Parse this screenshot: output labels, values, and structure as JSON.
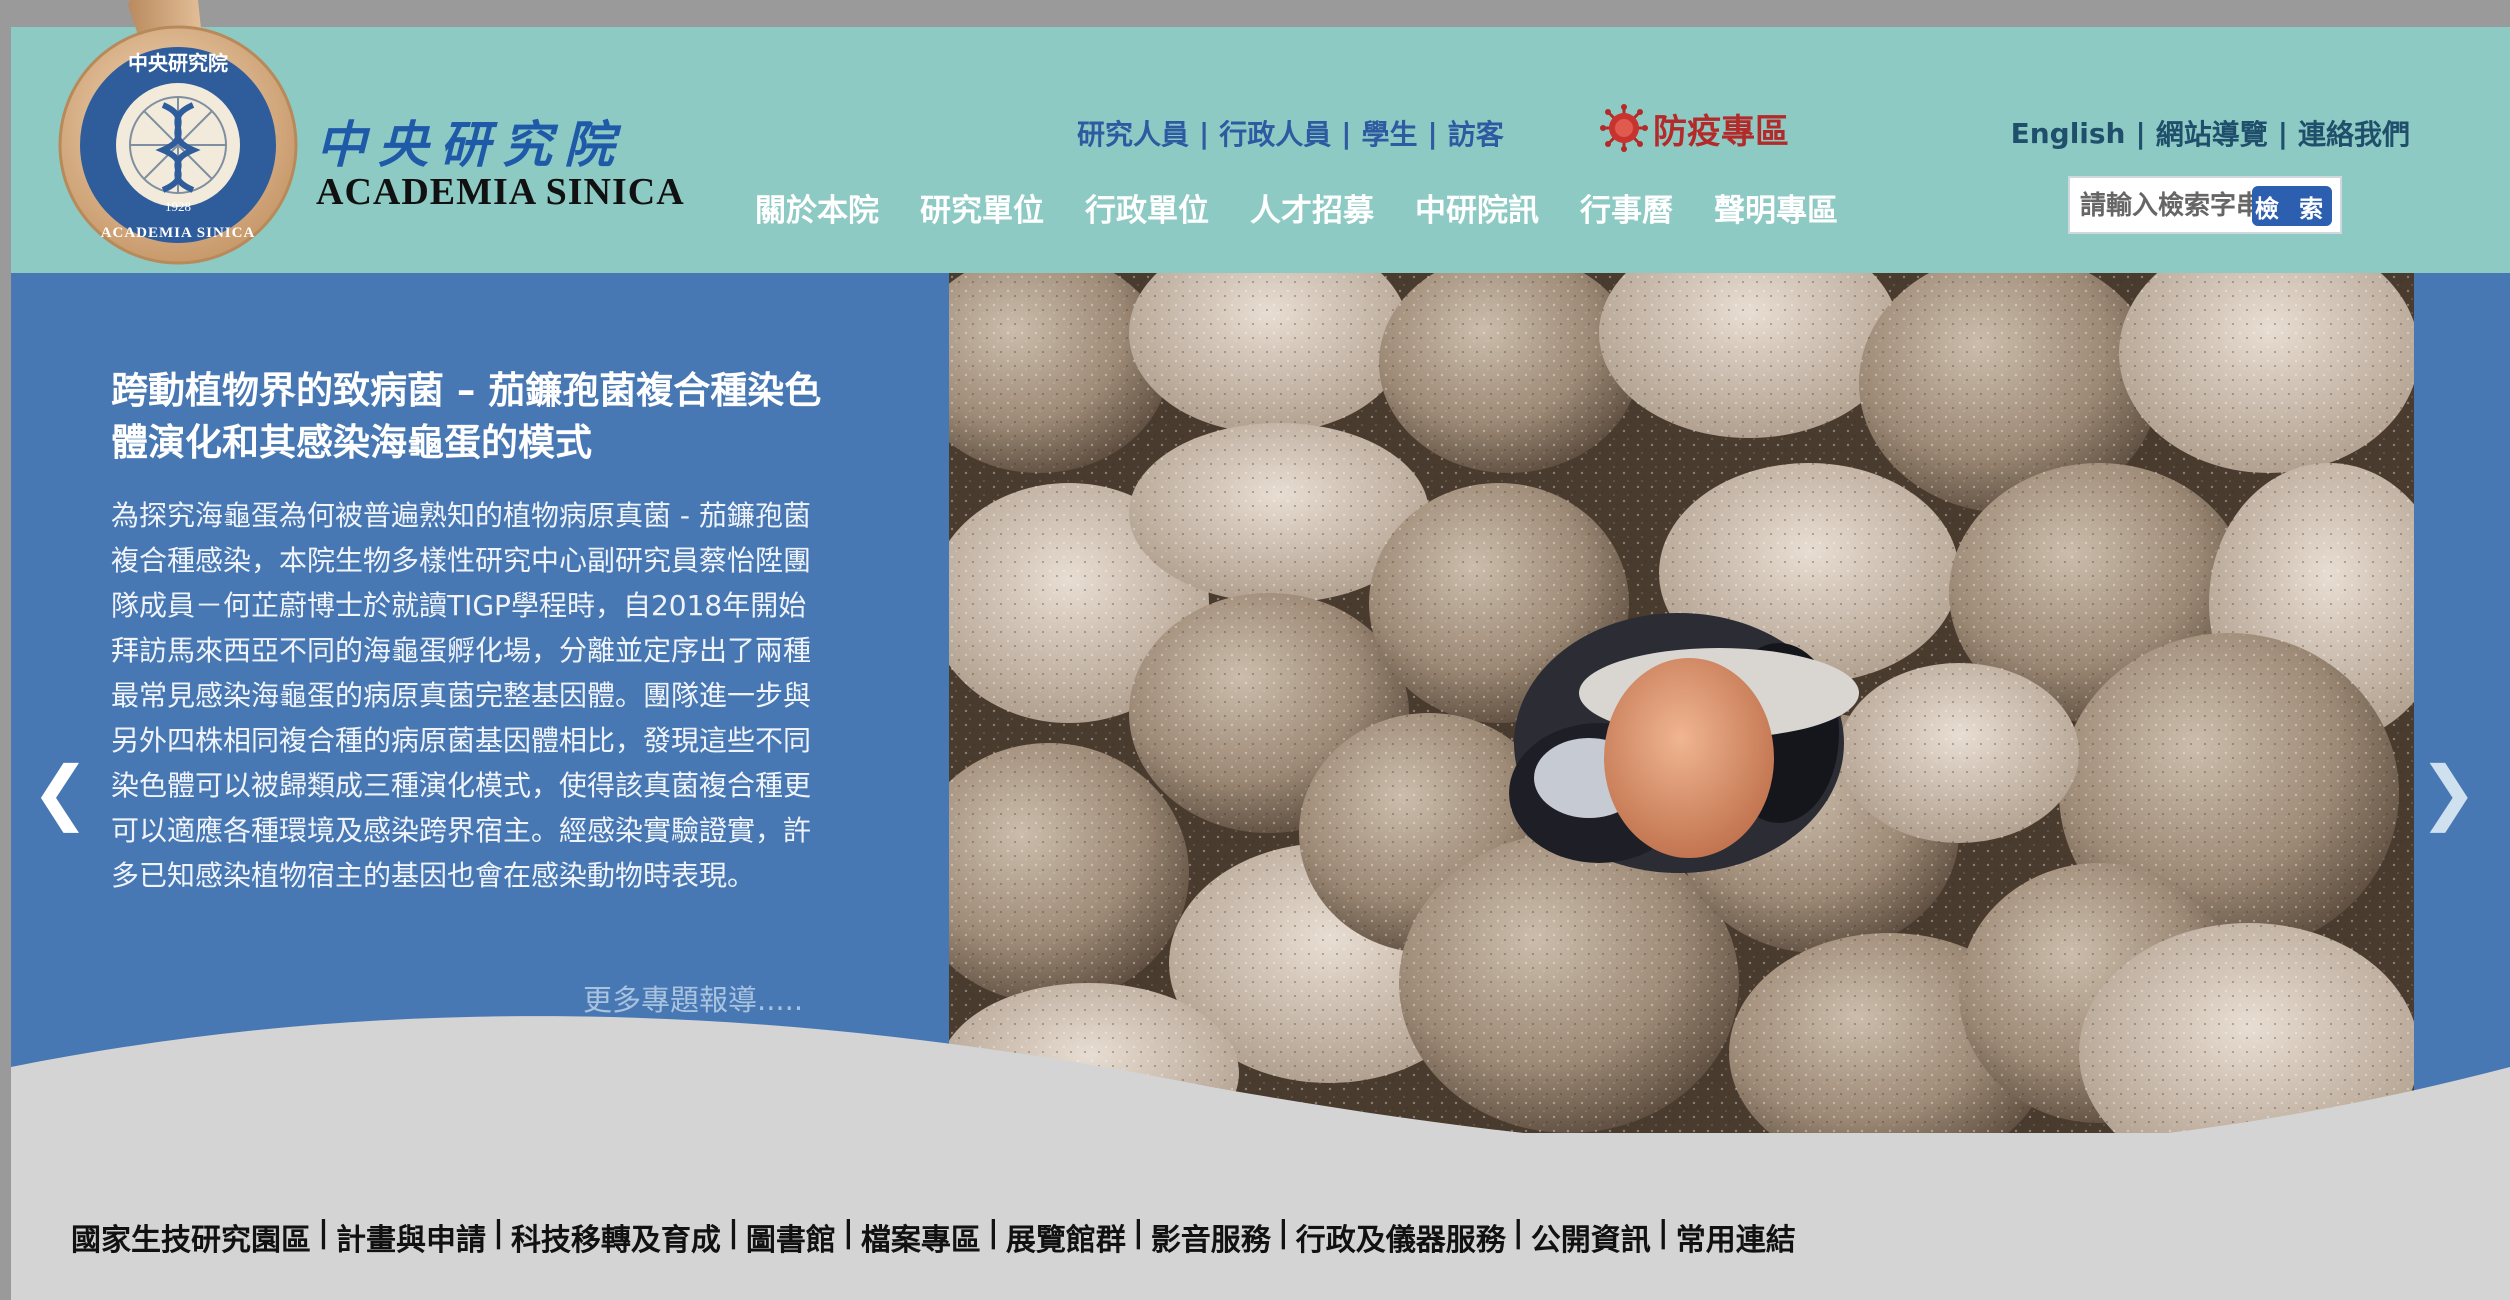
{
  "logo": {
    "name_cn": "中央研究院",
    "name_en": "ACADEMIA SINICA",
    "seal_text_top": "中央研究院",
    "seal_text_bottom": "ACADEMIA SINICA",
    "seal_year": "1928"
  },
  "role_links": [
    "研究人員",
    "行政人員",
    "學生",
    "訪客"
  ],
  "epidemic": {
    "label": "防疫專區",
    "icon": "virus-icon"
  },
  "util_links": [
    "English",
    "網站導覽",
    "連絡我們"
  ],
  "main_nav": [
    "關於本院",
    "研究單位",
    "行政單位",
    "人才招募",
    "中研院訊",
    "行事曆",
    "聲明專區"
  ],
  "search": {
    "placeholder": "請輸入檢索字串",
    "button": "檢 索"
  },
  "hero": {
    "title": "跨動植物界的致病菌 – 茄鐮孢菌複合種染色體演化和其感染海龜蛋的模式",
    "body": "為探究海龜蛋為何被普遍熟知的植物病原真菌 - 茄鐮孢菌複合種感染，本院生物多樣性研究中心副研究員蔡怡陞團隊成員－何芷蔚博士於就讀TIGP學程時，自2018年開始拜訪馬來西亞不同的海龜蛋孵化場，分離並定序出了兩種最常見感染海龜蛋的病原真菌完整基因體。團隊進一步與另外四株相同複合種的病原菌基因體相比，發現這些不同染色體可以被歸類成三種演化模式，使得該真菌複合種更可以適應各種環境及感染跨界宿主。經感染實驗證實，許多已知感染植物宿主的基因也會在感染動物時表現。",
    "more_link": "更多專題報導.....",
    "prev_icon": "chevron-left-icon",
    "next_icon": "chevron-right-icon"
  },
  "footer_links": [
    "國家生技研究園區",
    "計畫與申請",
    "科技移轉及育成",
    "圖書館",
    "檔案專區",
    "展覽館群",
    "影音服務",
    "行政及儀器服務",
    "公開資訊",
    "常用連結"
  ],
  "colors": {
    "header_bg": "#8ecac4",
    "hero_bg": "#4778b4",
    "link_blue": "#2d5aa0",
    "epidemic_red": "#b22a2a",
    "search_button": "#2d5fb0",
    "wave_grey": "#d4d4d4"
  }
}
